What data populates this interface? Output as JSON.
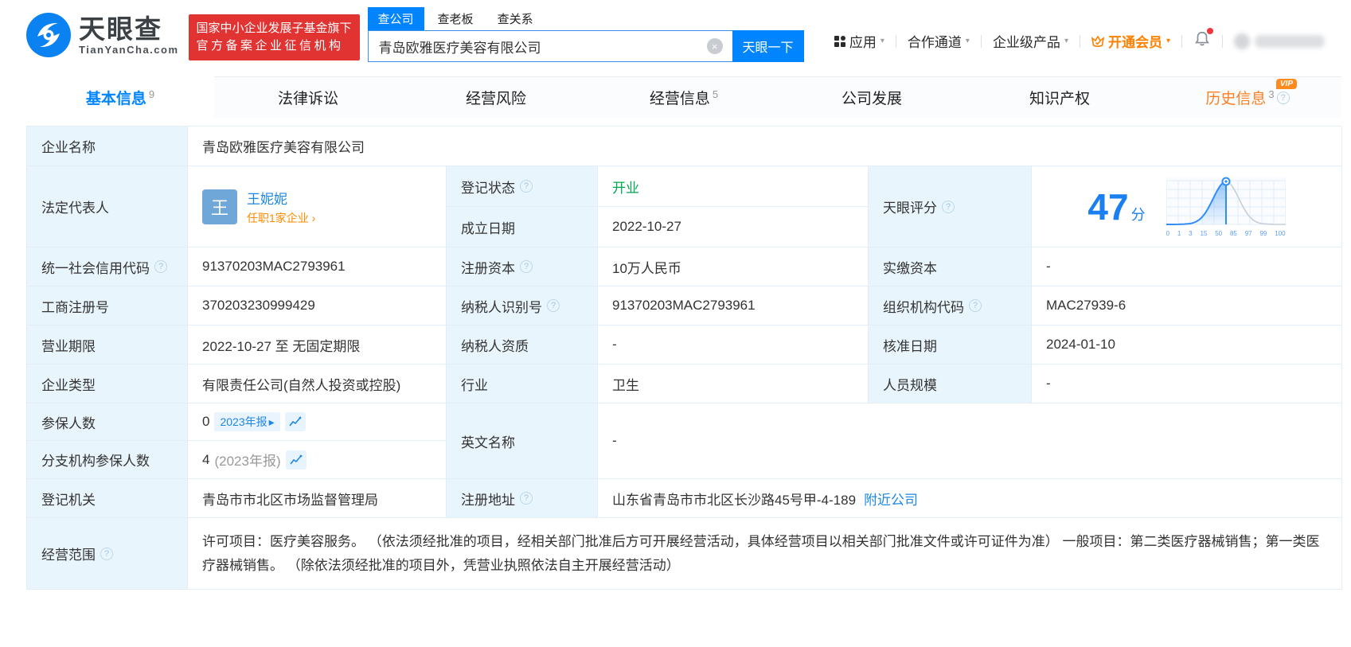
{
  "icons": {
    "caret_down": "▾",
    "caret_right": "▸",
    "chevron_right": "›",
    "close": "×",
    "question": "?"
  },
  "colors": {
    "accent": "#0084ff",
    "orange": "#ff8000",
    "green": "#00a850",
    "badge_red": "#e23333",
    "label_bg": "#e9f5fc"
  },
  "header": {
    "brand": "天眼查",
    "brand_domain": "TianYanCha.com",
    "badge_line1": "国家中小企业发展子基金旗下",
    "badge_line2": "官方备案企业征信机构",
    "search": {
      "tabs": [
        "查公司",
        "查老板",
        "查关系"
      ],
      "active_tab": "查公司",
      "input_value": "青岛欧雅医疗美容有限公司",
      "button_label": "天眼一下"
    },
    "nav": {
      "apps": "应用",
      "partner": "合作通道",
      "enterprise": "企业级产品",
      "vip": "开通会员"
    }
  },
  "tabs": [
    {
      "label": "基本信息",
      "count": "9"
    },
    {
      "label": "法律诉讼",
      "count": ""
    },
    {
      "label": "经营风险",
      "count": ""
    },
    {
      "label": "经营信息",
      "count": "5"
    },
    {
      "label": "公司发展",
      "count": ""
    },
    {
      "label": "知识产权",
      "count": ""
    },
    {
      "label": "历史信息",
      "count": "3",
      "vip_tag": "VIP"
    }
  ],
  "fields": {
    "company_name": {
      "label": "企业名称",
      "value": "青岛欧雅医疗美容有限公司"
    },
    "legal_rep": {
      "label": "法定代表人",
      "avatar_text": "王",
      "name": "王妮妮",
      "tenure_link": "任职1家企业 ›"
    },
    "reg_status": {
      "label": "登记状态",
      "value": "开业"
    },
    "est_date": {
      "label": "成立日期",
      "value": "2022-10-27"
    },
    "tyc_score": {
      "label": "天眼评分",
      "value": "47",
      "unit": "分"
    },
    "credit_code": {
      "label": "统一社会信用代码",
      "value": "91370203MAC2793961"
    },
    "reg_capital": {
      "label": "注册资本",
      "value": "10万人民币"
    },
    "paid_capital": {
      "label": "实缴资本",
      "value": "-"
    },
    "reg_number": {
      "label": "工商注册号",
      "value": "370203230999429"
    },
    "taxpayer_id": {
      "label": "纳税人识别号",
      "value": "91370203MAC2793961"
    },
    "org_code": {
      "label": "组织机构代码",
      "value": "MAC27939-6"
    },
    "business_term": {
      "label": "营业期限",
      "value": "2022-10-27 至 无固定期限"
    },
    "taxpayer_quali": {
      "label": "纳税人资质",
      "value": "-"
    },
    "approval_date": {
      "label": "核准日期",
      "value": "2024-01-10"
    },
    "company_type": {
      "label": "企业类型",
      "value": "有限责任公司(自然人投资或控股)"
    },
    "industry": {
      "label": "行业",
      "value": "卫生"
    },
    "staff_size": {
      "label": "人员规模",
      "value": "-"
    },
    "insured": {
      "label": "参保人数",
      "value": "0",
      "report_tag": "2023年报"
    },
    "branch_insured": {
      "label": "分支机构参保人数",
      "value": "4",
      "report_note": "(2023年报)"
    },
    "english_name": {
      "label": "英文名称",
      "value": "-"
    },
    "reg_authority": {
      "label": "登记机关",
      "value": "青岛市市北区市场监督管理局"
    },
    "reg_address": {
      "label": "注册地址",
      "value": "山东省青岛市市北区长沙路45号甲-4-189",
      "nearby_link": "附近公司"
    },
    "business_scope": {
      "label": "经营范围",
      "value": "许可项目：医疗美容服务。 （依法须经批准的项目，经相关部门批准后方可开展经营活动，具体经营项目以相关部门批准文件或许可证件为准） 一般项目：第二类医疗器械销售；第一类医疗器械销售。 （除依法须经批准的项目外，凭营业执照依法自主开展经营活动）"
    }
  },
  "chart_data": {
    "type": "area",
    "title": "天眼评分",
    "score": 47,
    "unit": "分",
    "x_ticks": [
      "0",
      "1",
      "3",
      "15",
      "50",
      "85",
      "97",
      "99",
      "100"
    ],
    "marker_tick": "50",
    "shape": "bell-curve, left half filled blue up to marker at 50, right half gray outline",
    "legend_position": "none",
    "grid": true
  }
}
